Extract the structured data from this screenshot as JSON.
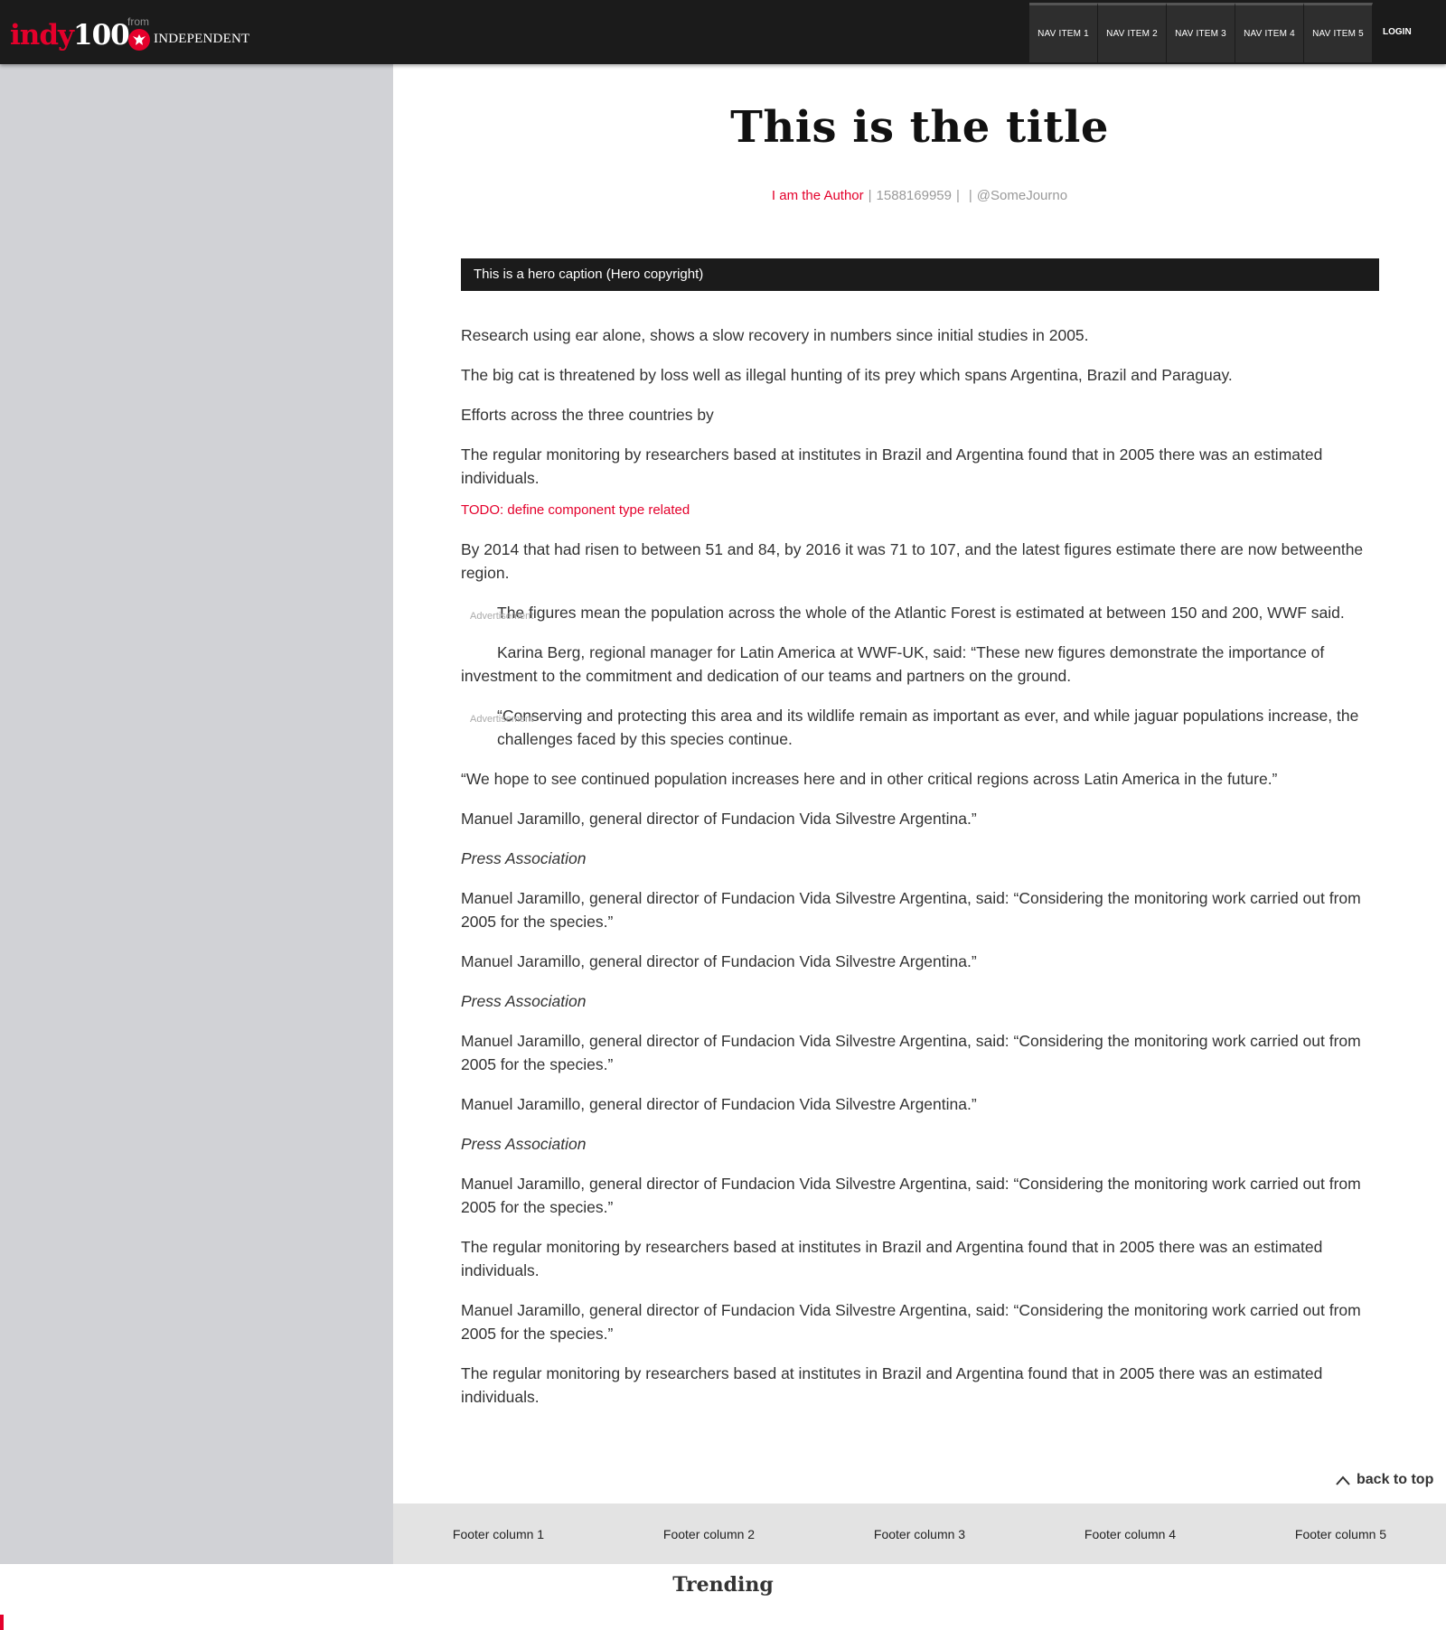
{
  "header": {
    "logo_part1": "indy",
    "logo_part2": "100",
    "from": "from",
    "publisher": "INDEPENDENT",
    "nav_items": [
      "NAV ITEM 1",
      "NAV ITEM 2",
      "NAV ITEM 3",
      "NAV ITEM 4",
      "NAV ITEM 5"
    ],
    "login": "LOGIN"
  },
  "article": {
    "title": "This is the title",
    "author": "I am the Author",
    "timestamp": "1588169959",
    "twitter": "@SomeJourno",
    "hero_caption": "This is a hero caption (Hero copyright)",
    "paragraphs": {
      "p1": "Research using ear alone, shows a slow recovery in numbers since initial studies in 2005.",
      "p2": "The big cat is threatened by loss well as illegal hunting of its prey which spans Argentina, Brazil and Paraguay.",
      "p3": "Efforts across the three countries by",
      "p4": "The regular monitoring by researchers based at institutes in Brazil and Argentina found that in 2005 there was an estimated individuals.",
      "todo": "TODO: define component type related",
      "p5": "By 2014 that had risen to between 51 and 84, by 2016 it was 71 to 107, and the latest figures estimate there are now betweenthe region.",
      "p6": "The figures mean the population across the whole of the Atlantic Forest is estimated at between 150 and 200, WWF said.",
      "p7": "Karina Berg, regional manager for Latin America at WWF-UK, said: “These new figures demonstrate the importance of investment to the commitment and dedication of our teams and partners on the ground.",
      "p8": "“Conserving and protecting this area and its wildlife remain as important as ever, and while jaguar populations increase, the challenges faced by this species continue.",
      "p9": "“We hope to see continued population increases here and in other critical regions across Latin America in the future.”",
      "p10": "Manuel Jaramillo, general director of Fundacion Vida Silvestre Argentina.”",
      "p11": "Press Association",
      "p12": "Manuel Jaramillo, general director of Fundacion Vida Silvestre Argentina, said: “Considering the monitoring work carried out from 2005 for the species.”",
      "p13": "Manuel Jaramillo, general director of Fundacion Vida Silvestre Argentina.”",
      "p14": "Press Association",
      "p15": "Manuel Jaramillo, general director of Fundacion Vida Silvestre Argentina, said: “Considering the monitoring work carried out from 2005 for the species.”",
      "p16": "Manuel Jaramillo, general director of Fundacion Vida Silvestre Argentina.”",
      "p17": "Press Association",
      "p18": "Manuel Jaramillo, general director of Fundacion Vida Silvestre Argentina, said: “Considering the monitoring work carried out from 2005 for the species.”",
      "p19": "The regular monitoring by researchers based at institutes in Brazil and Argentina found that in 2005 there was an estimated individuals.",
      "p20": "Manuel Jaramillo, general director of Fundacion Vida Silvestre Argentina, said: “Considering the monitoring work carried out from 2005 for the species.”",
      "p21": "The regular monitoring by researchers based at institutes in Brazil and Argentina found that in 2005 there was an estimated individuals."
    },
    "ad_label": "Advertisement",
    "back_to_top": "back to top"
  },
  "footer": {
    "columns": [
      "Footer column 1",
      "Footer column 2",
      "Footer column 3",
      "Footer column 4",
      "Footer column 5"
    ]
  },
  "trending": "Trending",
  "icons": {
    "publisher_logo": "eagle-icon",
    "back_to_top": "chevron-up-icon"
  },
  "colors": {
    "brand_red": "#e4002b",
    "header_bg": "#1b1b1b",
    "sidebar_bg": "#d1d2d6",
    "footer_bg": "#e3e3e3"
  }
}
